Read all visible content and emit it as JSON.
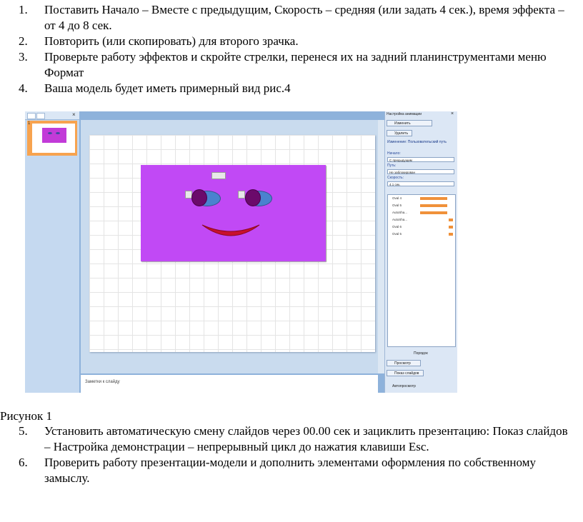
{
  "steps_top": [
    {
      "num": "1.",
      "text": "Поставить Начало – Вместе с предыдущим, Скорость – средняя (или задать 4 сек.), время эффекта – от 4 до 8 сек."
    },
    {
      "num": "2.",
      "text": "Повторить (или скопировать) для второго зрачка."
    },
    {
      "num": "3.",
      "text": "Проверьте работу эффектов и скройте стрелки, перенеся их на задний планинструментами меню Формат"
    },
    {
      "num": "4.",
      "text": "Ваша модель будет иметь примерный вид рис.4"
    }
  ],
  "caption": "Рисунок 1",
  "steps_bottom": [
    {
      "num": "5.",
      "text": "Установить автоматическую смену слайдов через 00.00 сек и зациклить презентацию: Показ слайдов – Настройка демонстрации – непрерывный цикл до нажатия клавиши Esc."
    },
    {
      "num": "6.",
      "text": "Проверить работу презентации-модели и дополнить элементами оформления по собственному замыслу."
    }
  ],
  "screenshot": {
    "thumb_number": "1",
    "notes_placeholder": "Заметки к слайду",
    "pane": {
      "title": "Настройка анимации",
      "add_effect": "Изменить",
      "remove": "Удалить",
      "effect_name": "Изменение: Пользовательский путь",
      "start_label": "Начало:",
      "start_value": "С предыдущим",
      "path_label": "Путь:",
      "path_value": "Не заблокирован",
      "speed_label": "Скорость:",
      "speed_value": "4.1 сек.",
      "effects": [
        "Oval 4",
        "Oval 5",
        "AutoSha...",
        "AutoSha...",
        "Oval 6",
        "Oval 5"
      ],
      "reorder_label": "Порядок",
      "play": "Просмотр",
      "slideshow": "Показ слайдов",
      "autopreview": "Автопросмотр"
    },
    "colors": {
      "face": "#c149f5",
      "eye": "#4a82cf",
      "pupil": "#6b0a6b",
      "smile": "#c8102e",
      "effect_bar": "#f0913a"
    }
  }
}
